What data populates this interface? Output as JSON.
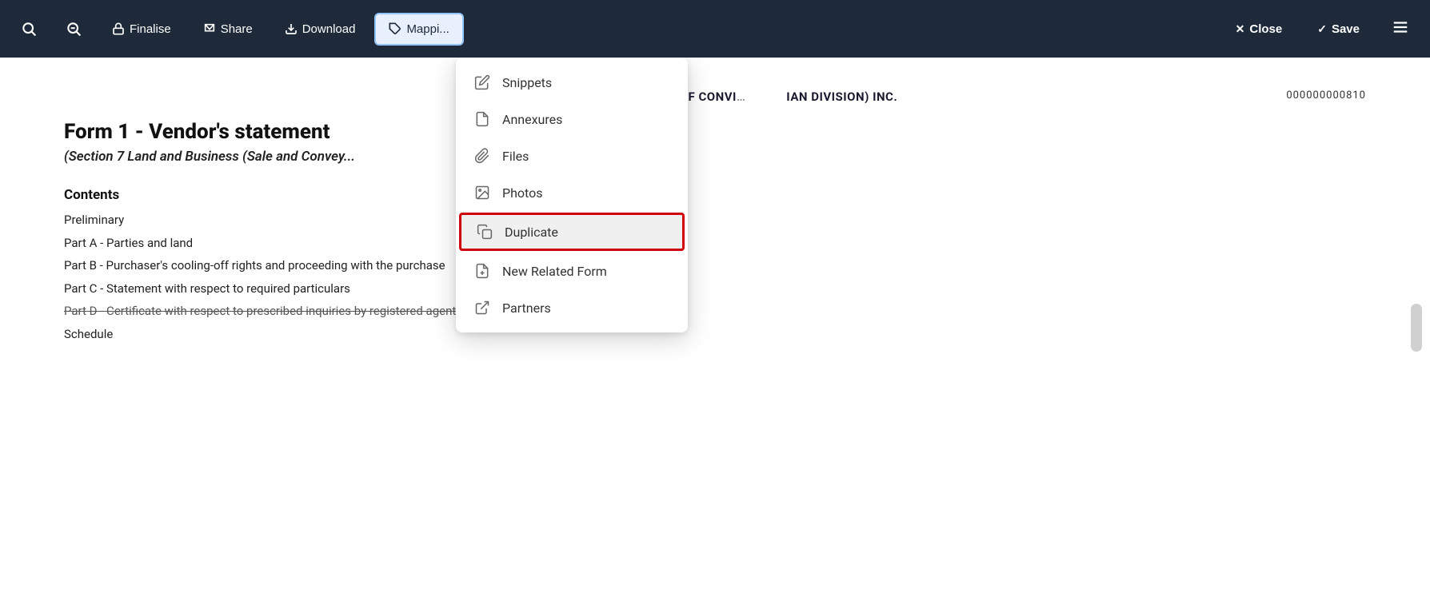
{
  "toolbar": {
    "search_zoom_out_label": "🔍",
    "search_label": "🔎",
    "finalise_label": "Finalise",
    "share_label": "Share",
    "download_label": "Download",
    "mapping_label": "Mappi...",
    "close_label": "Close",
    "save_label": "Save",
    "menu_label": "≡"
  },
  "dropdown": {
    "items": [
      {
        "id": "snippets",
        "label": "Snippets",
        "icon": "edit"
      },
      {
        "id": "annexures",
        "label": "Annexures",
        "icon": "file"
      },
      {
        "id": "files",
        "label": "Files",
        "icon": "paperclip"
      },
      {
        "id": "photos",
        "label": "Photos",
        "icon": "image"
      },
      {
        "id": "duplicate",
        "label": "Duplicate",
        "icon": "copy",
        "highlighted": true
      },
      {
        "id": "new-related-form",
        "label": "New Related Form",
        "icon": "file-plus"
      },
      {
        "id": "partners",
        "label": "Partners",
        "icon": "external-link"
      }
    ]
  },
  "document": {
    "header": "AUSTRALIAN INSTITUTE OF CONVI... ...IAN DIVISION) INC.",
    "id": "000000000810",
    "title": "Form 1 - Vendor's statement",
    "subtitle": "(Section 7 Land and Business (Sale and Convey...",
    "contents_title": "Contents",
    "contents_items": [
      {
        "text": "Preliminary",
        "strikethrough": false
      },
      {
        "text": "Part A - Parties and land",
        "strikethrough": false
      },
      {
        "text": "Part B - Purchaser's cooling-off rights and proceeding with the purchase",
        "strikethrough": false
      },
      {
        "text": "Part C - Statement with respect to required particulars",
        "strikethrough": false
      },
      {
        "text": "Part D - Certificate with respect to prescribed inquiries by registered agent ——",
        "strikethrough": true
      },
      {
        "text": "Schedule",
        "strikethrough": false
      }
    ]
  }
}
